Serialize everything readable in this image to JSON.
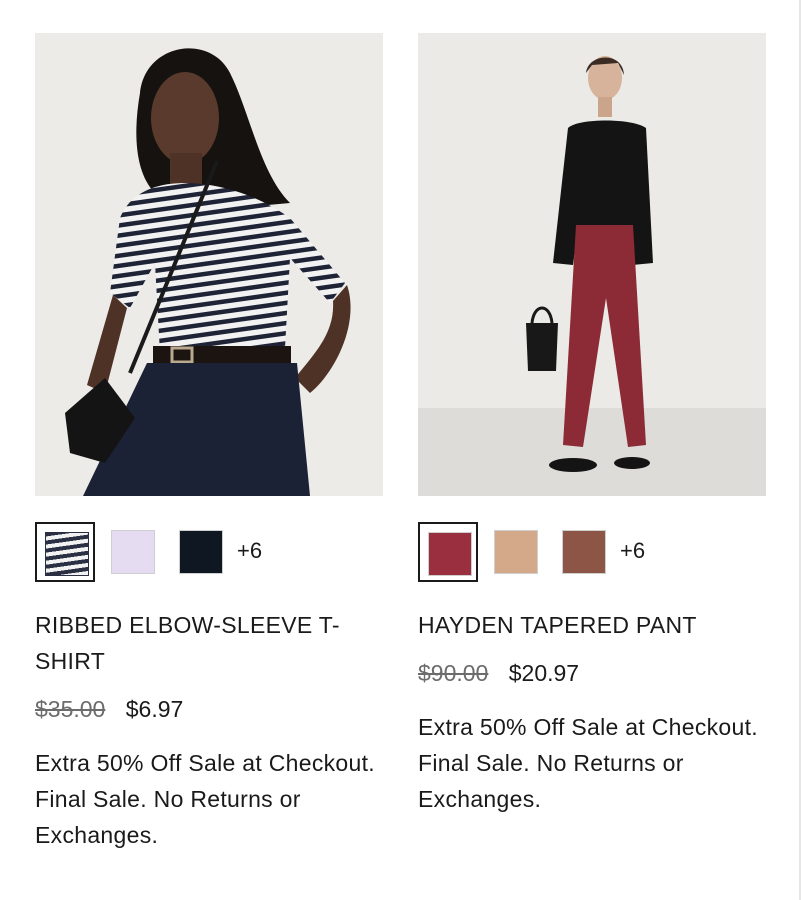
{
  "products": [
    {
      "title": "RIBBED ELBOW-SLEEVE T-SHIRT",
      "more_colors": "+6",
      "original_price": "$35.00",
      "sale_price": "$6.97",
      "promo": "Extra 50% Off Sale at Checkout. Final Sale. No Returns or Exchanges.",
      "swatches": [
        {
          "name": "navy-white-stripe",
          "color": "#2a2f44",
          "selected": true
        },
        {
          "name": "lavender",
          "color": "#e6dcf1",
          "selected": false
        },
        {
          "name": "black",
          "color": "#0f1722",
          "selected": false
        }
      ]
    },
    {
      "title": "HAYDEN TAPERED PANT",
      "more_colors": "+6",
      "original_price": "$90.00",
      "sale_price": "$20.97",
      "promo": "Extra 50% Off Sale at Checkout. Final Sale. No Returns or Exchanges.",
      "swatches": [
        {
          "name": "burgundy",
          "color": "#9a2f3f",
          "selected": true
        },
        {
          "name": "tan",
          "color": "#d3a98a",
          "selected": false
        },
        {
          "name": "brown",
          "color": "#8d5545",
          "selected": false
        }
      ]
    }
  ]
}
